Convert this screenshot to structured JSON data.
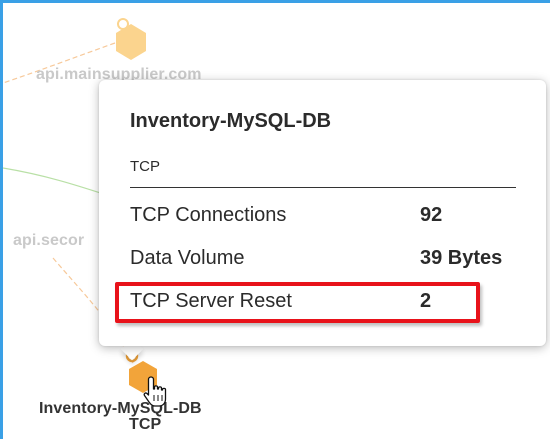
{
  "graph": {
    "nodes": [
      {
        "id": "api-mainsupplier",
        "label": "api.mainsupplier.com",
        "sublabel": "",
        "state": "faded"
      },
      {
        "id": "api-secondary",
        "label": "api.secor",
        "sublabel": "",
        "state": "faded"
      },
      {
        "id": "inventory-db",
        "label": "Inventory-MySQL-DB",
        "sublabel": "TCP",
        "state": "active"
      }
    ],
    "colors": {
      "node_fill_faded": "#fbd48e",
      "node_fill_active": "#f2a43a",
      "edge_green": "#b9e0a6",
      "edge_orange": "#f7c99a",
      "frame_border": "#3aa0e6"
    }
  },
  "tooltip": {
    "title": "Inventory-MySQL-DB",
    "subtitle": "TCP",
    "rows": [
      {
        "label": "TCP Connections",
        "value": "92"
      },
      {
        "label": "Data Volume",
        "value": "39 Bytes"
      },
      {
        "label": "TCP Server Reset",
        "value": "2"
      }
    ]
  },
  "highlight": {
    "row": "TCP Server Reset",
    "color": "#e8121a"
  },
  "cursor": {
    "icon": "hand-pointer-icon"
  }
}
